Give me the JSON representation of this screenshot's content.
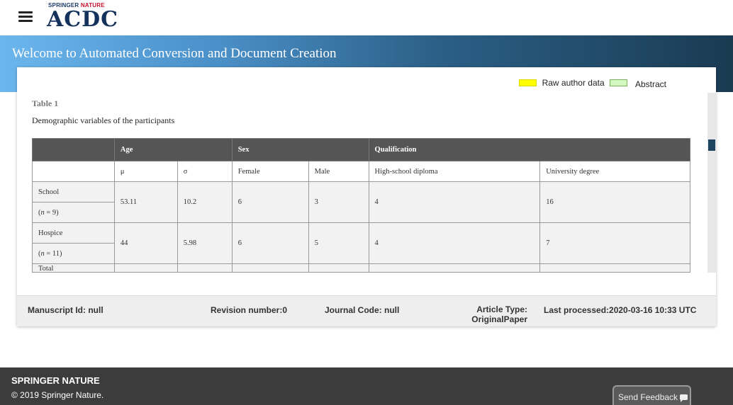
{
  "header": {
    "brand_small_prefix": "SPRINGER",
    "brand_small_suffix": "NATURE",
    "brand_big": "ACDC"
  },
  "banner": {
    "title": "Welcome to Automated Conversion and Document Creation"
  },
  "legend": {
    "raw_author_data": "Raw author data",
    "abstract": "Abstract"
  },
  "table": {
    "label": "Table 1",
    "caption": "Demographic variables of the participants",
    "groups": [
      "Age",
      "Sex",
      "Qualification"
    ],
    "subheaders": [
      "μ",
      "σ",
      "Female",
      "Male",
      "High-school diploma",
      "University degree"
    ],
    "rows": [
      {
        "name": "School",
        "n_label": "(n = 9)",
        "values": [
          "53.11",
          "10.2",
          "6",
          "3",
          "4",
          "16"
        ]
      },
      {
        "name": "Hospice",
        "n_label": "(n = 11)",
        "values": [
          "44",
          "5.98",
          "6",
          "5",
          "4",
          "7"
        ]
      }
    ],
    "partial_row_name": "Total"
  },
  "meta": {
    "manuscript_id": "Manuscript Id: null",
    "revision": "Revision number:0",
    "journal_code": "Journal Code: null",
    "article_type_label": "Article Type:",
    "article_type_value": "OriginalPaper",
    "last_processed": "Last processed:2020-03-16 10:33 UTC"
  },
  "footer": {
    "brand": "SPRINGER NATURE",
    "copyright": "© 2019 Springer Nature.",
    "feedback": "Send Feedback"
  },
  "colors": {
    "header_dark": "#555555",
    "legend_yellow": "#ffff00",
    "legend_green": "#d5f7c0",
    "footer_bg": "#3c3c3c"
  }
}
